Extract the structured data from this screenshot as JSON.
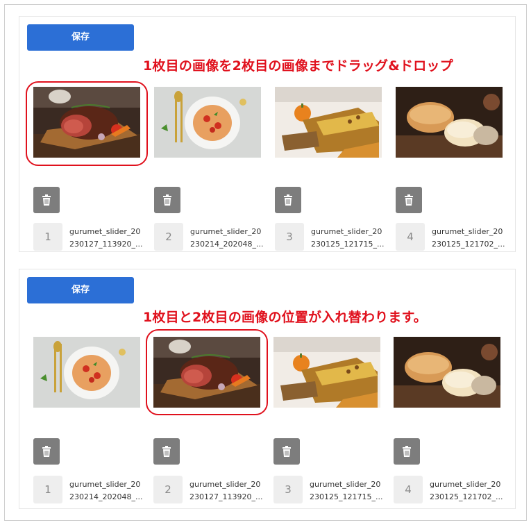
{
  "panel_before": {
    "save_label": "保存",
    "annotation": "1枚目の画像を2枚目の画像までドラッグ&ドロップ",
    "items": [
      {
        "order": "1",
        "filename_line1": "gurumet_slider_20",
        "filename_line2": "230127_113920_...",
        "image": "steak"
      },
      {
        "order": "2",
        "filename_line1": "gurumet_slider_20",
        "filename_line2": "230214_202048_...",
        "image": "pasta"
      },
      {
        "order": "3",
        "filename_line1": "gurumet_slider_20",
        "filename_line2": "230125_121715_...",
        "image": "pumpkin-bread"
      },
      {
        "order": "4",
        "filename_line1": "gurumet_slider_20",
        "filename_line2": "230125_121702_...",
        "image": "bread-rolls"
      }
    ]
  },
  "panel_after": {
    "save_label": "保存",
    "annotation": "1枚目と2枚目の画像の位置が入れ替わります。",
    "items": [
      {
        "order": "1",
        "filename_line1": "gurumet_slider_20",
        "filename_line2": "230214_202048_...",
        "image": "pasta"
      },
      {
        "order": "2",
        "filename_line1": "gurumet_slider_20",
        "filename_line2": "230127_113920_...",
        "image": "steak"
      },
      {
        "order": "3",
        "filename_line1": "gurumet_slider_20",
        "filename_line2": "230125_121715_...",
        "image": "pumpkin-bread"
      },
      {
        "order": "4",
        "filename_line1": "gurumet_slider_20",
        "filename_line2": "230125_121702_...",
        "image": "bread-rolls"
      }
    ]
  },
  "icons": {
    "delete": "trash-icon"
  },
  "colors": {
    "save_button": "#2c6fd6",
    "annotation": "#e0111d",
    "trash_button": "#7d7d7d",
    "highlight": "#e0111d"
  }
}
